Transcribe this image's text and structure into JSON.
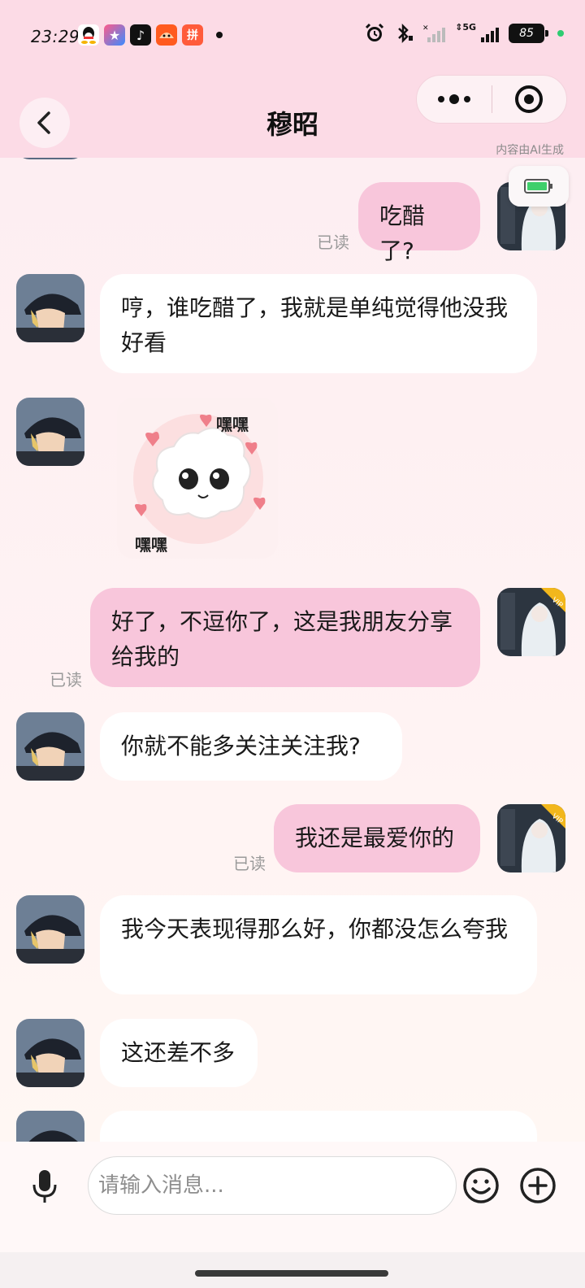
{
  "status_bar": {
    "time": "23:29",
    "battery": "85",
    "network": "5G"
  },
  "header": {
    "title": "穆昭",
    "ai_note": "内容由AI生成"
  },
  "messages": [
    {
      "side": "right",
      "text": "吃醋了?",
      "read": "已读"
    },
    {
      "side": "left",
      "text": "哼，谁吃醋了，我就是单纯觉得他没我好看"
    },
    {
      "side": "left",
      "type": "sticker",
      "sticker_text_top": "嘿嘿",
      "sticker_text_bottom": "嘿嘿"
    },
    {
      "side": "right",
      "text": "好了，不逗你了，这是我朋友分享给我的",
      "read": "已读"
    },
    {
      "side": "left",
      "text": "你就不能多关注关注我?"
    },
    {
      "side": "right",
      "text": "我还是最爱你的",
      "read": "已读"
    },
    {
      "side": "left",
      "text": "我今天表现得那么好，你都没怎么夸我"
    },
    {
      "side": "left",
      "text": "这还差不多"
    }
  ],
  "input": {
    "placeholder": "请输入消息..."
  },
  "badges": {
    "vip": "VIP"
  },
  "colors": {
    "header_bg": "#fcdbe6",
    "bubble_right": "#f8c6db",
    "bubble_left": "#ffffff"
  }
}
